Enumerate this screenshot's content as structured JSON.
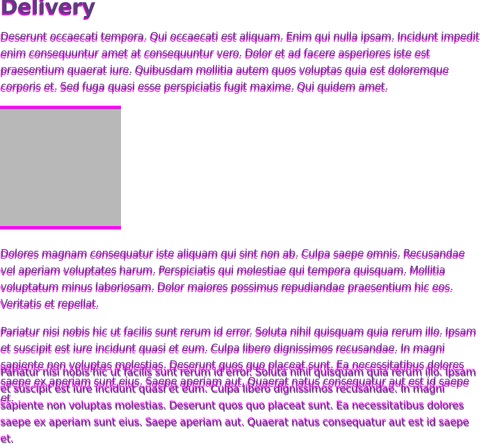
{
  "heading": "Delivery",
  "paragraphs": {
    "p1": "Deserunt occaecati tempora. Qui occaecati est aliquam. Enim qui nulla ipsam. Incidunt impedit enim consequuntur amet at consequuntur vero. Dolor et ad facere asperiores iste est praesentium quaerat iure. Quibusdam mollitia autem quos voluptas quia est doloremque corporis et. Sed fuga quasi esse perspiciatis fugit maxime. Qui quidem amet.",
    "p2": "Dolores magnam consequatur iste aliquam qui sint non ab. Culpa saepe omnis. Recusandae vel aperiam voluptates harum. Perspiciatis qui molestiae qui tempora quisquam. Mollitia voluptatum minus laboriosam. Dolor maiores possimus repudiandae praesentium hic eos. Veritatis et repellat.",
    "p3": "Pariatur nisi nobis hic ut facilis sunt rerum id error. Soluta nihil quisquam quia rerum illo. Ipsam et suscipit est iure incidunt quasi et eum. Culpa libero dignissimos recusandae. In magni sapiente non voluptas molestias. Deserunt quos quo placeat sunt. Ea necessitatibus dolores saepe ex aperiam sunt eius. Saepe aperiam aut. Quaerat natus consequatur aut est id saepe et."
  },
  "colors": {
    "text": "#5a3f78",
    "ghost": "#ff00ff",
    "image_placeholder": "#b8b8b8"
  }
}
